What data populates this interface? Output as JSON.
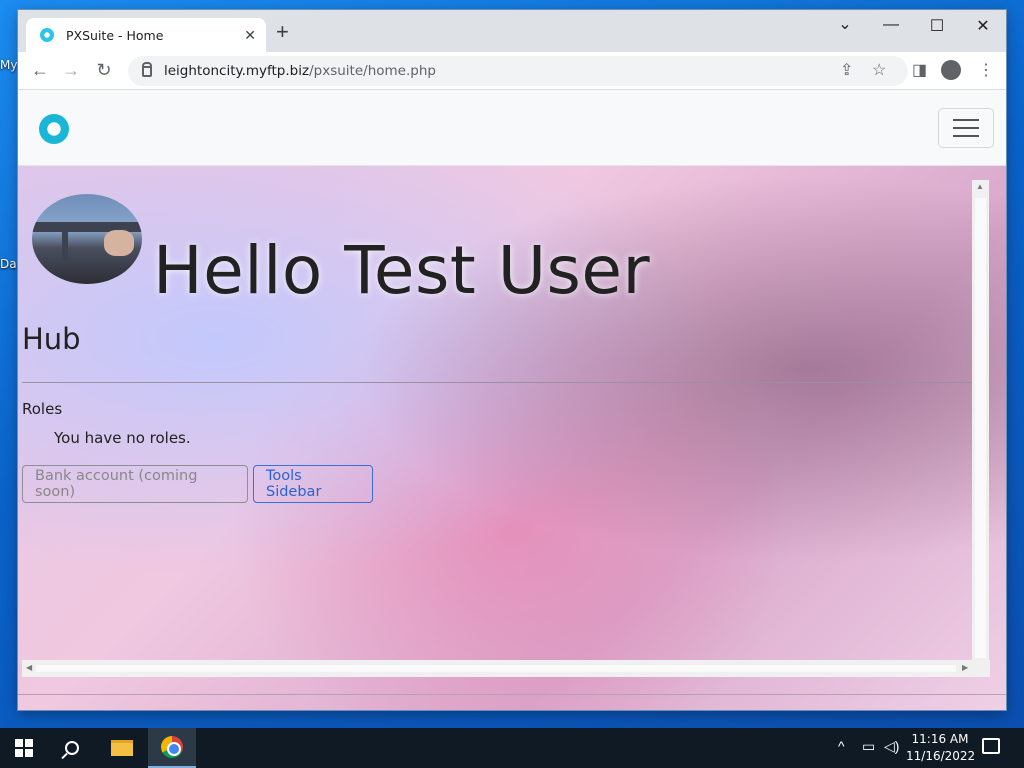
{
  "desktop": {
    "icon_labels": [
      "My",
      "Da"
    ]
  },
  "browser": {
    "tab_title": "PXSuite - Home",
    "tab_close": "✕",
    "new_tab": "+",
    "url_host": "leightoncity.myftp.biz",
    "url_path": "/pxsuite/home.php",
    "controls": {
      "minimize": "—",
      "maximize": "☐",
      "close": "✕",
      "tab_search": "⌄"
    },
    "nav": {
      "back": "←",
      "forward": "→",
      "reload": "↻"
    }
  },
  "page": {
    "greeting": "Hello Test User",
    "hub_heading": "Hub",
    "roles_heading": "Roles",
    "roles_text": "You have no roles.",
    "buttons": {
      "bank": "Bank account (coming soon)",
      "tools": "Tools Sidebar"
    }
  },
  "taskbar": {
    "time": "11:16 AM",
    "date": "11/16/2022"
  }
}
